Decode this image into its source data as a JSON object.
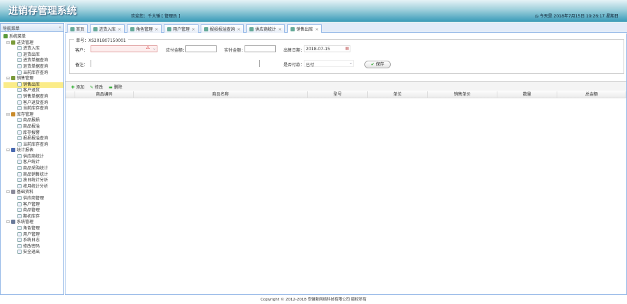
{
  "header": {
    "title": "进销存管理系统",
    "welcome": "欢迎您：千大锤 [ 管理员 ]",
    "clock": "今天是 2018年7月15日 19:26:17 星期日"
  },
  "sidebar": {
    "title": "导航菜单",
    "collapse": "«",
    "root": "系统菜单",
    "groups": [
      {
        "label": "进货管理",
        "color": "#7a9a3a",
        "items": [
          "进货入库",
          "退货出库",
          "进货单据查询",
          "退货单据查询",
          "当前库存查询"
        ]
      },
      {
        "label": "销售管理",
        "color": "#7a9a3a",
        "items": [
          "销售出库",
          "客户退货",
          "销售单据查询",
          "客户退货查询",
          "当前库存查询"
        ]
      },
      {
        "label": "库存管理",
        "color": "#c98a2a",
        "items": [
          "商品报损",
          "商品报溢",
          "库存报警",
          "报损报溢查询",
          "当前库存查询"
        ]
      },
      {
        "label": "统计报表",
        "color": "#4a6ab0",
        "items": [
          "供应商统计",
          "客户统计",
          "商品采购统计",
          "商品销售统计",
          "按日统计分析",
          "按月统计分析"
        ]
      },
      {
        "label": "基础资料",
        "color": "#8a8a9a",
        "items": [
          "供应商管理",
          "客户管理",
          "商品管理",
          "期初库存"
        ]
      },
      {
        "label": "系统管理",
        "color": "#6a7a9a",
        "items": [
          "角色管理",
          "用户管理",
          "系统日志",
          "修改密码",
          "安全退出"
        ]
      }
    ],
    "selected": "销售出库"
  },
  "tabs": [
    {
      "label": "首页",
      "close": false
    },
    {
      "label": "进货入库",
      "close": true
    },
    {
      "label": "角色管理",
      "close": true
    },
    {
      "label": "用户管理",
      "close": true
    },
    {
      "label": "报损报溢查询",
      "close": true
    },
    {
      "label": "供应商统计",
      "close": true
    },
    {
      "label": "销售出库",
      "close": true,
      "active": true
    }
  ],
  "form": {
    "legend": "单号：XS201807150001",
    "customer_label": "客户：",
    "customer_value": "",
    "payable_label": "应付金额：",
    "payable_value": "",
    "paid_label": "实付金额：",
    "paid_value": "",
    "date_label": "出售日期：",
    "date_value": "2018-07-15",
    "remark_label": "备注：",
    "remark_value": "",
    "payment_label": "是否付款：",
    "payment_value": "已付",
    "save": "保存"
  },
  "toolbar": {
    "add": "添加",
    "edit": "修改",
    "delete": "删除"
  },
  "grid": {
    "columns": [
      "商品编码",
      "商品名称",
      "型号",
      "单位",
      "销售单价",
      "数量",
      "总金额"
    ]
  },
  "footer": "Copyright © 2012-2018 安徽新网络科技有限公司 版权所有"
}
